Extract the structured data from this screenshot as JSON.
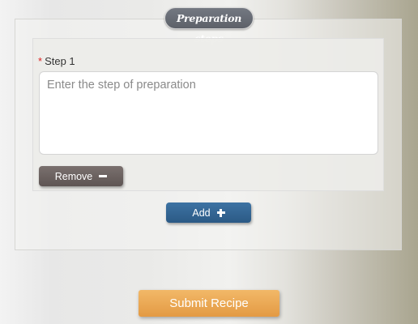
{
  "section": {
    "legend": "Preparation steps"
  },
  "steps": [
    {
      "required_marker": "*",
      "label": "Step 1",
      "value": "",
      "placeholder": "Enter the step of preparation",
      "remove_label": "Remove",
      "remove_icon": "minus-icon"
    }
  ],
  "add_button": {
    "label": "Add",
    "icon": "plus-icon"
  },
  "submit_button": {
    "label": "Submit Recipe"
  },
  "colors": {
    "legend_bg": "#676b73",
    "remove_bg": "#6b6260",
    "add_bg": "#34668f",
    "submit_bg": "#eba955",
    "required_star": "#dd2222"
  }
}
